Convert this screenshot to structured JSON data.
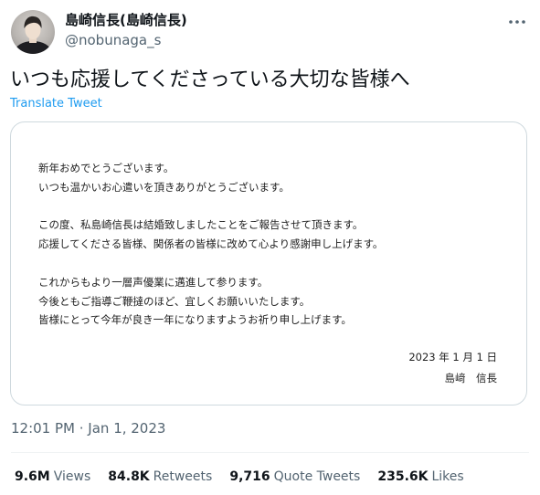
{
  "author": {
    "display_name": "島崎信長(島崎信長)",
    "handle": "@nobunaga_s"
  },
  "tweet": {
    "text": "いつも応援してくださっている大切な皆様へ",
    "translate_label": "Translate Tweet",
    "timestamp_time": "12:01 PM",
    "timestamp_sep": " · ",
    "timestamp_date": "Jan 1, 2023"
  },
  "letter": {
    "p1": [
      "新年おめでとうございます。",
      "いつも温かいお心遣いを頂きありがとうございます。"
    ],
    "p2": [
      "この度、私島崎信長は結婚致しましたことをご報告させて頂きます。",
      "応援してくださる皆様、関係者の皆様に改めて心より感謝申し上げます。"
    ],
    "p3": [
      "これからもより一層声優業に邁進して参ります。",
      "今後ともご指導ご鞭撻のほど、宜しくお願いいたします。",
      "皆様にとって今年が良き一年になりますようお祈り申し上げます。"
    ],
    "date": "2023 年 1 月 1 日",
    "signature": "島﨑　信長"
  },
  "stats": [
    {
      "num": "9.6M",
      "label": "Views"
    },
    {
      "num": "84.8K",
      "label": "Retweets"
    },
    {
      "num": "9,716",
      "label": "Quote Tweets"
    },
    {
      "num": "235.6K",
      "label": "Likes"
    }
  ],
  "icons": {
    "more": "more-horizontal-icon",
    "avatar": "profile-photo"
  },
  "colors": {
    "link": "#1d9bf0",
    "secondary": "#536471",
    "border": "#cfd9de"
  }
}
